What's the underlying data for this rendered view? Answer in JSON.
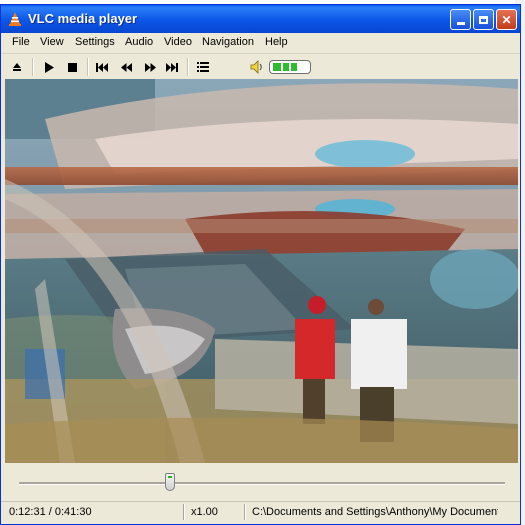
{
  "window": {
    "title": "VLC media player"
  },
  "menu": [
    "File",
    "View",
    "Settings",
    "Audio",
    "Video",
    "Navigation",
    "Help"
  ],
  "toolbar": {
    "icons": [
      "eject-icon",
      "play-icon",
      "stop-icon",
      "previous-icon",
      "rewind-icon",
      "fast-forward-icon",
      "next-icon",
      "playlist-icon",
      "speaker-icon"
    ],
    "volume_fraction": 0.75
  },
  "seek": {
    "position_fraction": 0.31
  },
  "status": {
    "time": "0:12:31 / 0:41:30",
    "speed": "x1.00",
    "path": "C:\\Documents and Settings\\Anthony\\My Documents"
  },
  "colors": {
    "titlebar": "#0b56e8",
    "volume": "#2fbb2f",
    "chrome": "#ece9d8"
  }
}
